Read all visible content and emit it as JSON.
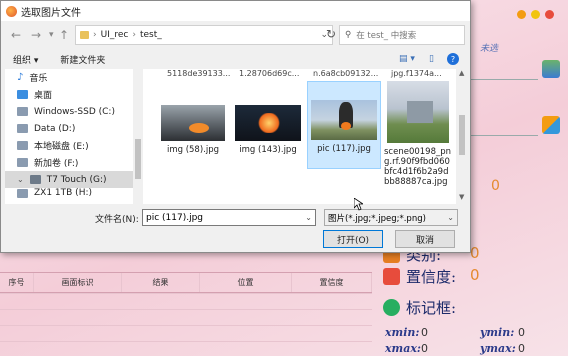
{
  "dialog": {
    "title": "选取图片文件",
    "address": {
      "crumbs": [
        "UI_rec",
        "test_"
      ],
      "search_placeholder": "在 test_ 中搜索"
    },
    "toolbar": {
      "organize": "组织",
      "new_folder": "新建文件夹"
    },
    "nav_items": [
      {
        "label": "音乐"
      },
      {
        "label": "桌面"
      },
      {
        "label": "Windows-SSD (C:)"
      },
      {
        "label": "Data (D:)"
      },
      {
        "label": "本地磁盘 (E:)"
      },
      {
        "label": "新加卷 (F:)"
      },
      {
        "label": "T7 Touch (G:)"
      },
      {
        "label": "ZX1 1TB (H:)"
      }
    ],
    "partial_top_names": [
      "5118de39133...",
      "1.28706d69c...",
      "n.6a8cb09132...",
      "jpg.f1374a..."
    ],
    "files": [
      {
        "name": "img (58).jpg"
      },
      {
        "name": "img (143).jpg"
      },
      {
        "name": "pic (117).jpg"
      },
      {
        "name": "scene00198_png.rf.90f9fbd060bfc4d1f6b2a9dbb88887ca.jpg"
      }
    ],
    "filename_label": "文件名(N):",
    "filename_value": "pic (117).jpg",
    "filter_value": "图片(*.jpg;*.jpeg;*.png)",
    "open_button": "打开(O)",
    "cancel_button": "取消"
  },
  "app": {
    "path_hint": "未选",
    "stats": [
      {
        "label": "类别:",
        "value": "0"
      },
      {
        "label": "置信度:",
        "value": "0"
      }
    ],
    "big_zero": "0",
    "box_label": "标记框:",
    "coords": {
      "xmin_label": "xmin:",
      "xmin": "0",
      "ymin_label": "ymin:",
      "ymin": "0",
      "xmax_label": "xmax:",
      "xmax": "0",
      "ymax_label": "ymax:",
      "ymax": "0"
    },
    "table_headers": [
      "序号",
      "画面标识",
      "结果",
      "位置",
      "置信度"
    ],
    "colors": {
      "accent": "#0078d7",
      "value_orange": "#e58a2f"
    }
  }
}
